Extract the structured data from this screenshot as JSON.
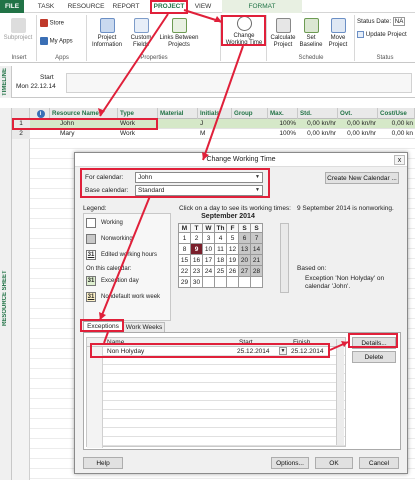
{
  "tabs": [
    "FILE",
    "TASK",
    "RESOURCE",
    "REPORT",
    "PROJECT",
    "VIEW",
    "FORMAT"
  ],
  "ribbon": {
    "subproject": "Subproject",
    "store": "Store",
    "my_apps": "My Apps",
    "project_information": "Project Information",
    "custom_fields": "Custom Fields",
    "links_between_projects": "Links Between Projects",
    "change_working_time": "Change Working Time",
    "calculate_project": "Calculate Project",
    "set_baseline": "Set Baseline",
    "move_project": "Move Project",
    "status_date_label": "Status Date:",
    "status_date_value": "NA",
    "update_project": "Update Project",
    "groups": {
      "insert": "Insert",
      "apps": "Apps",
      "properties": "Properties",
      "schedule": "Schedule",
      "status": "Status"
    }
  },
  "timeline": {
    "side_label": "TIMELINE",
    "start_label": "Start",
    "start_date": "Mon 22.12.14"
  },
  "sheet": {
    "side_label": "RESOURCE SHEET",
    "columns": [
      "Resource Name",
      "Type",
      "Material",
      "Initials",
      "Group",
      "Max.",
      "Std.",
      "Ovt.",
      "Cost/Use"
    ],
    "info_icon": "i",
    "rows": [
      {
        "num": "1",
        "name": "John",
        "type": "Work",
        "material": "",
        "initials": "J",
        "group": "",
        "max": "100%",
        "std": "0,00 kn/hr",
        "ovt": "0,00 kn/hr",
        "cost": "0,00 kn"
      },
      {
        "num": "2",
        "name": "Mary",
        "type": "Work",
        "material": "",
        "initials": "M",
        "group": "",
        "max": "100%",
        "std": "0,00 kn/hr",
        "ovt": "0,00 kn/hr",
        "cost": "0,00 kn"
      }
    ]
  },
  "dialog": {
    "title": "Change Working Time",
    "for_calendar_label": "For calendar:",
    "for_calendar_value": "John",
    "base_calendar_label": "Base calendar:",
    "base_calendar_value": "Standard",
    "create_new_calendar": "Create New Calendar ...",
    "legend_title": "Legend:",
    "legend": {
      "working": "Working",
      "nonworking": "Nonworking",
      "edited_num": "31",
      "edited": "Edited working hours",
      "on_this_calendar": "On this calendar:",
      "exception_num": "31",
      "exception": "Exception day",
      "nondefault_num": "31",
      "nondefault": "Nondefault work week"
    },
    "click_hint": "Click on a day to see its working times:",
    "month_title": "September 2014",
    "weekdays": [
      "M",
      "T",
      "W",
      "Th",
      "F",
      "S",
      "S"
    ],
    "weeks": [
      [
        "1",
        "2",
        "3",
        "4",
        "5",
        "6",
        "7"
      ],
      [
        "8",
        "9",
        "10",
        "11",
        "12",
        "13",
        "14"
      ],
      [
        "15",
        "16",
        "17",
        "18",
        "19",
        "20",
        "21"
      ],
      [
        "22",
        "23",
        "24",
        "25",
        "26",
        "27",
        "28"
      ],
      [
        "29",
        "30",
        "",
        "",
        "",
        "",
        ""
      ]
    ],
    "selected_day": "9",
    "info_text": "9 September 2014 is nonworking.",
    "based_on_label": "Based on:",
    "based_on_text": "Exception 'Non Holyday' on calendar 'John'.",
    "tab_exceptions": "Exceptions",
    "tab_work_weeks": "Work Weeks",
    "table_headers": [
      "Name",
      "Start",
      "Finish"
    ],
    "exceptions": [
      {
        "num": "1",
        "name": "Non Holyday",
        "start": "25.12.2014",
        "finish": "25.12.2014"
      }
    ],
    "details_button": "Details...",
    "delete_button": "Delete",
    "help_button": "Help",
    "options_button": "Options...",
    "ok_button": "OK",
    "cancel_button": "Cancel",
    "close_icon": "x"
  },
  "colors": {
    "accent": "#217346",
    "highlight": "#e0203a",
    "selection": "#d5e8c8"
  }
}
